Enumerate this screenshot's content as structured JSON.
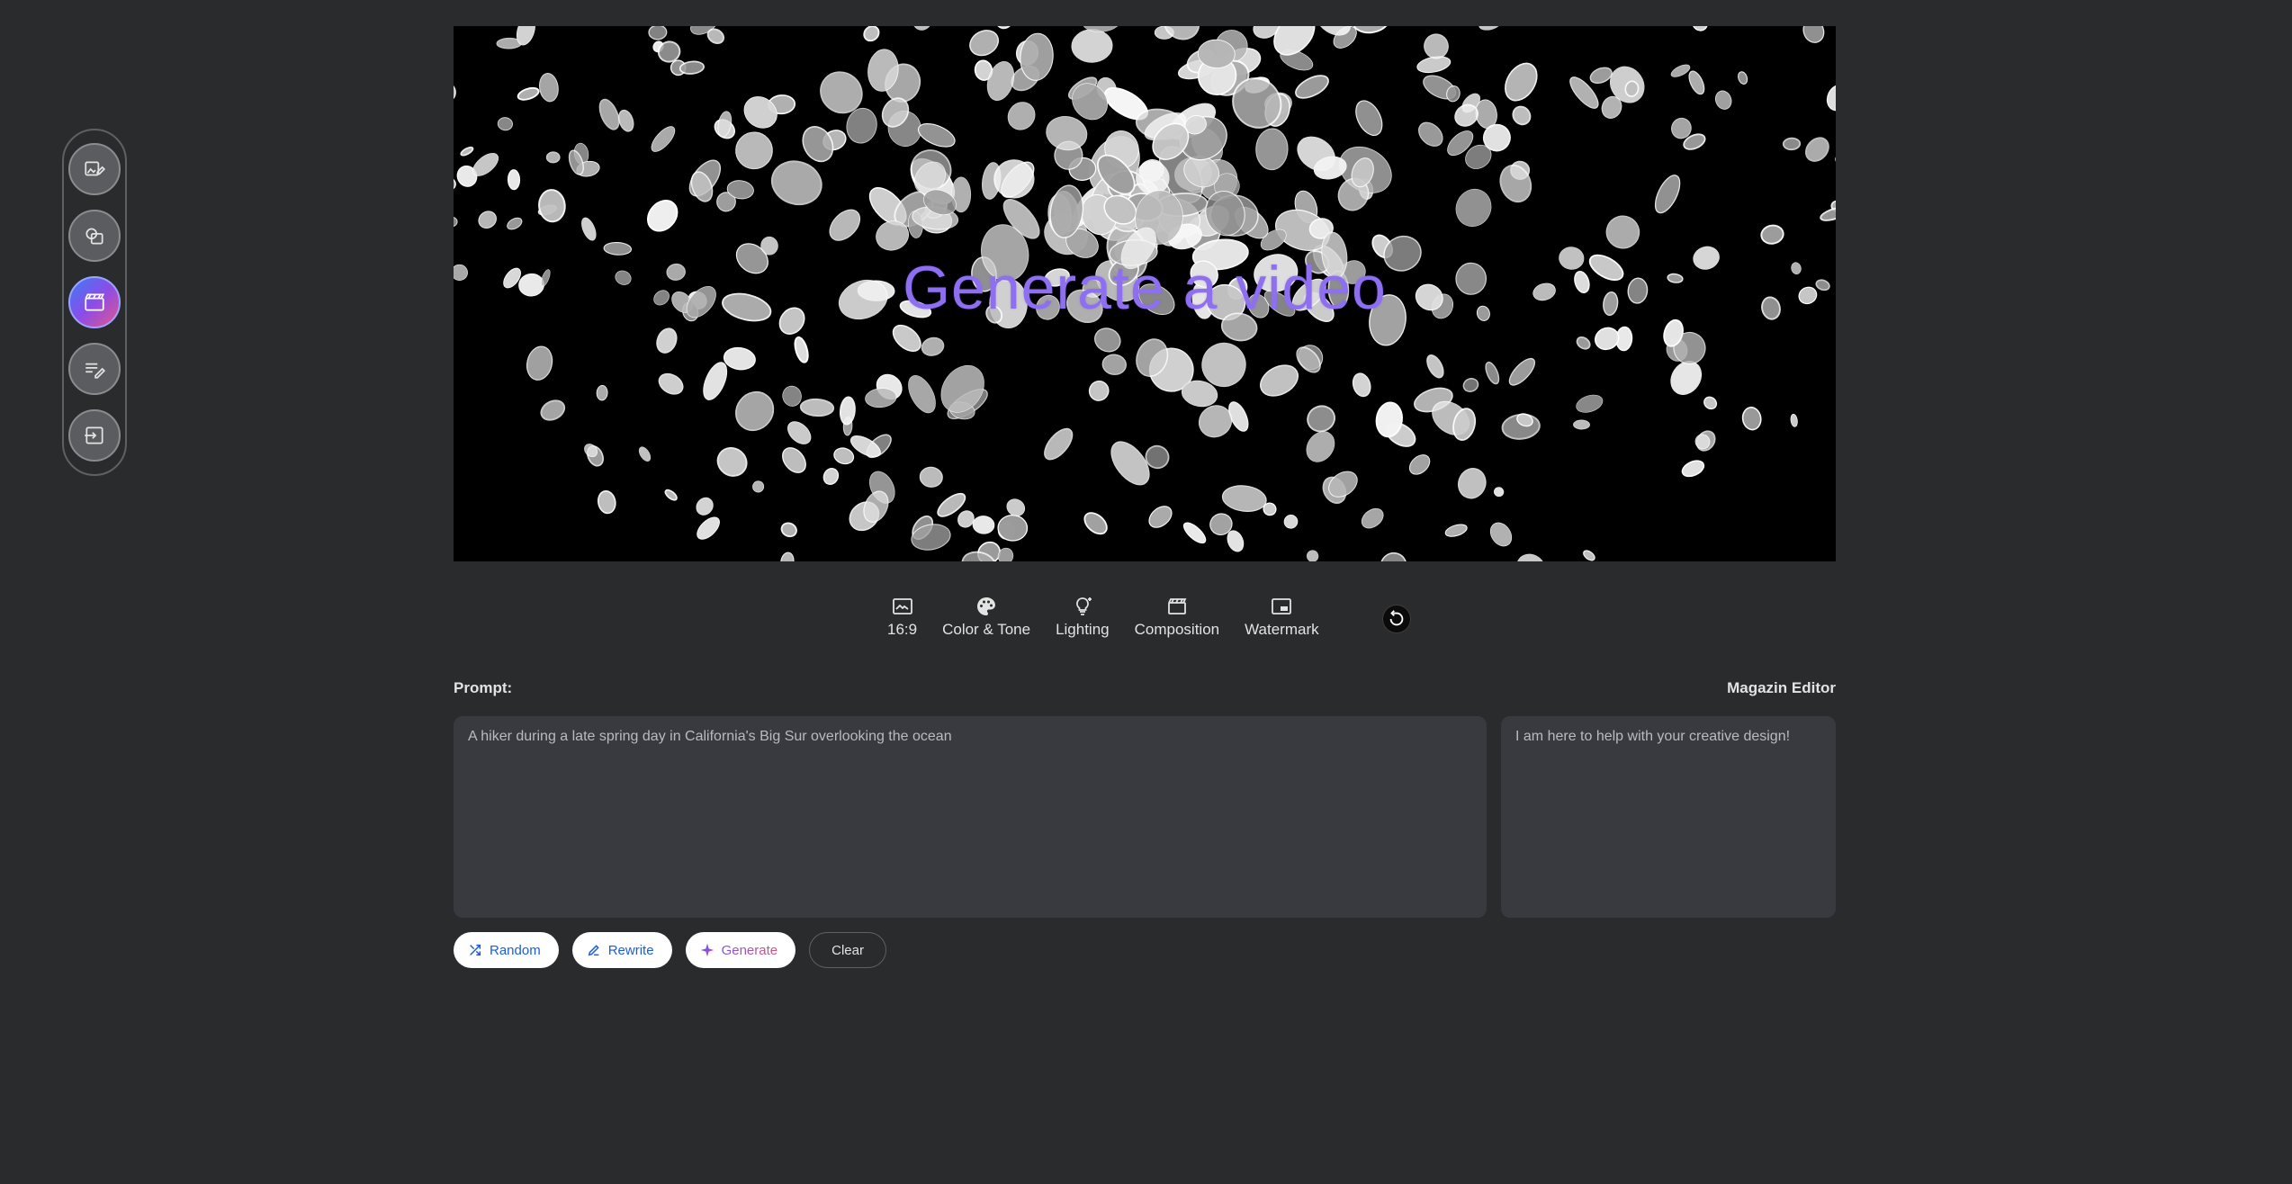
{
  "rail": {
    "items": [
      {
        "name": "image-edit-icon",
        "active": false
      },
      {
        "name": "image-stack-icon",
        "active": false
      },
      {
        "name": "video-clapper-icon",
        "active": true
      },
      {
        "name": "text-edit-icon",
        "active": false
      },
      {
        "name": "exit-icon",
        "active": false
      }
    ]
  },
  "hero": {
    "title": "Generate a video"
  },
  "toolbar": {
    "aspect_label": "16:9",
    "color_tone_label": "Color & Tone",
    "lighting_label": "Lighting",
    "composition_label": "Composition",
    "watermark_label": "Watermark"
  },
  "prompt": {
    "label": "Prompt:",
    "placeholder": "A hiker during a late spring day in California's Big Sur overlooking the ocean"
  },
  "editor": {
    "label": "Magazin Editor",
    "placeholder": "I am here to help with your creative design!"
  },
  "actions": {
    "random_label": "Random",
    "rewrite_label": "Rewrite",
    "generate_label": "Generate",
    "clear_label": "Clear"
  },
  "colors": {
    "background": "#2a2b2d",
    "field": "#393a3f",
    "accent_blue": "#1a5dd8",
    "title_purple": "#8e6ff0"
  }
}
